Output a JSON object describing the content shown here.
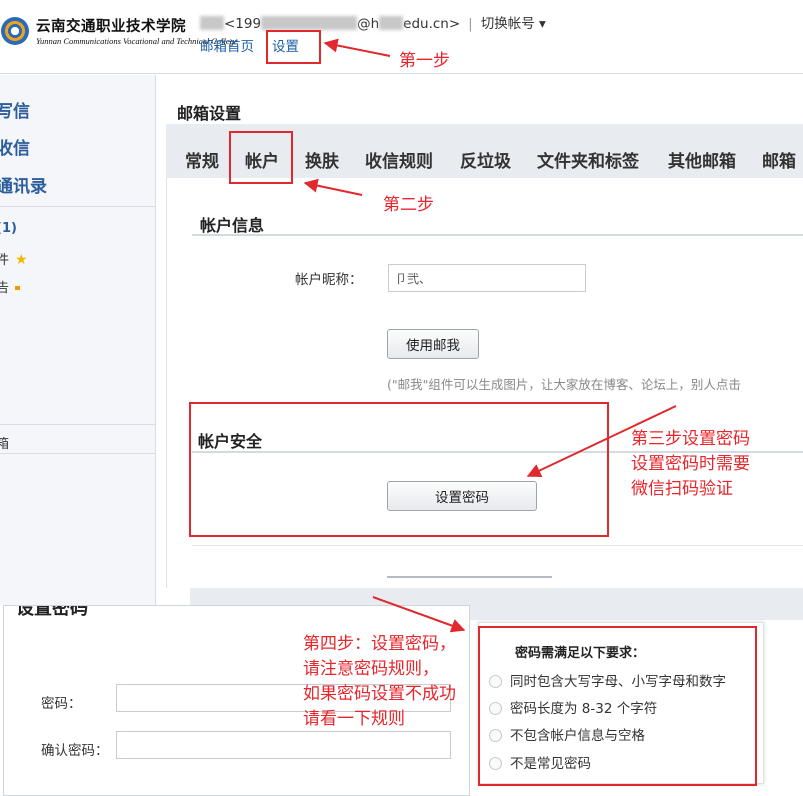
{
  "header": {
    "logo": {
      "name_cn": "云南交通职业技术学院",
      "name_en": "Yunnan Communications Vocational and Technical College"
    },
    "account": {
      "prefix": "<199",
      "mid": "@h",
      "domain": "edu.cn>"
    },
    "switch_account": "切换帐号",
    "nav": {
      "home": "邮箱首页",
      "settings": "设置"
    }
  },
  "sidebar": {
    "items": [
      "写信",
      "收信",
      "通讯录"
    ],
    "folders": [
      "(1)",
      "件",
      "告"
    ],
    "other": "箱"
  },
  "main": {
    "title": "邮箱设置",
    "tabs": [
      "常规",
      "帐户",
      "换肤",
      "收信规则",
      "反垃圾",
      "文件夹和标签",
      "其他邮箱",
      "邮箱"
    ],
    "active_tab": "帐户",
    "account_info": {
      "title": "帐户信息",
      "nickname_label": "帐户昵称：",
      "nickname_value": "卩弐、",
      "use_mail_button": "使用邮我",
      "hint": "(\"邮我\"组件可以生成图片，让大家放在博客、论坛上，别人点击"
    },
    "account_security": {
      "title": "帐户安全",
      "set_password_button": "设置密码"
    }
  },
  "dialog": {
    "title": "设置密码",
    "password_label": "密码：",
    "confirm_label": "确认密码：",
    "rules": {
      "title": "密码需满足以下要求：",
      "items": [
        "同时包含大写字母、小写字母和数字",
        "密码长度为 8-32 个字符",
        "不包含帐户信息与空格",
        "不是常见密码"
      ]
    }
  },
  "annotations": {
    "step1": "第一步",
    "step2": "第二步",
    "step3": [
      "第三步设置密码",
      "设置密码时需要",
      "微信扫码验证"
    ],
    "step4": [
      "第四步：设置密码，",
      "请注意密码规则，",
      "如果密码设置不成功",
      "请看一下规则"
    ]
  },
  "colors": {
    "annotation_red": "#e8252b",
    "link_blue": "#1f5fa8",
    "tab_bar": "#e8ecf1"
  }
}
